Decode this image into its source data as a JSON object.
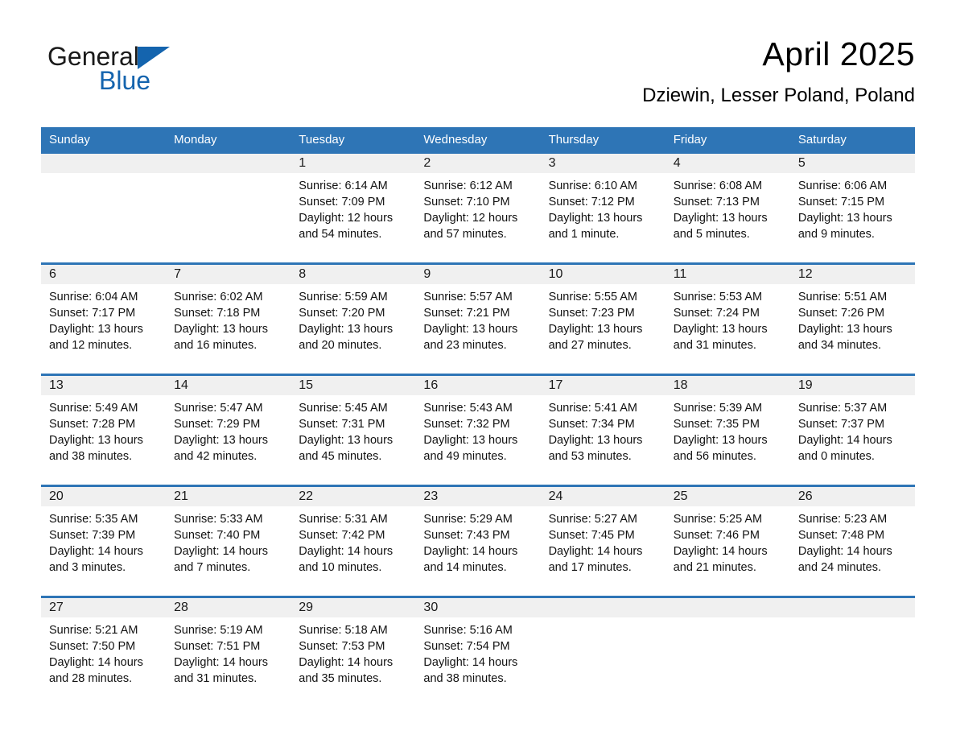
{
  "brand": {
    "name_part1": "General",
    "name_part2": "Blue",
    "logo_icon": "triangle-icon",
    "accent_color": "#1464ae"
  },
  "header": {
    "title": "April 2025",
    "subtitle": "Dziewin, Lesser Poland, Poland"
  },
  "theme": {
    "header_blue": "#2e75b6",
    "daynum_band": "#f0f0f0"
  },
  "weekday_headers": [
    "Sunday",
    "Monday",
    "Tuesday",
    "Wednesday",
    "Thursday",
    "Friday",
    "Saturday"
  ],
  "weeks": [
    [
      {
        "day": "",
        "sunrise": "",
        "sunset": "",
        "daylight1": "",
        "daylight2": ""
      },
      {
        "day": "",
        "sunrise": "",
        "sunset": "",
        "daylight1": "",
        "daylight2": ""
      },
      {
        "day": "1",
        "sunrise": "Sunrise: 6:14 AM",
        "sunset": "Sunset: 7:09 PM",
        "daylight1": "Daylight: 12 hours",
        "daylight2": "and 54 minutes."
      },
      {
        "day": "2",
        "sunrise": "Sunrise: 6:12 AM",
        "sunset": "Sunset: 7:10 PM",
        "daylight1": "Daylight: 12 hours",
        "daylight2": "and 57 minutes."
      },
      {
        "day": "3",
        "sunrise": "Sunrise: 6:10 AM",
        "sunset": "Sunset: 7:12 PM",
        "daylight1": "Daylight: 13 hours",
        "daylight2": "and 1 minute."
      },
      {
        "day": "4",
        "sunrise": "Sunrise: 6:08 AM",
        "sunset": "Sunset: 7:13 PM",
        "daylight1": "Daylight: 13 hours",
        "daylight2": "and 5 minutes."
      },
      {
        "day": "5",
        "sunrise": "Sunrise: 6:06 AM",
        "sunset": "Sunset: 7:15 PM",
        "daylight1": "Daylight: 13 hours",
        "daylight2": "and 9 minutes."
      }
    ],
    [
      {
        "day": "6",
        "sunrise": "Sunrise: 6:04 AM",
        "sunset": "Sunset: 7:17 PM",
        "daylight1": "Daylight: 13 hours",
        "daylight2": "and 12 minutes."
      },
      {
        "day": "7",
        "sunrise": "Sunrise: 6:02 AM",
        "sunset": "Sunset: 7:18 PM",
        "daylight1": "Daylight: 13 hours",
        "daylight2": "and 16 minutes."
      },
      {
        "day": "8",
        "sunrise": "Sunrise: 5:59 AM",
        "sunset": "Sunset: 7:20 PM",
        "daylight1": "Daylight: 13 hours",
        "daylight2": "and 20 minutes."
      },
      {
        "day": "9",
        "sunrise": "Sunrise: 5:57 AM",
        "sunset": "Sunset: 7:21 PM",
        "daylight1": "Daylight: 13 hours",
        "daylight2": "and 23 minutes."
      },
      {
        "day": "10",
        "sunrise": "Sunrise: 5:55 AM",
        "sunset": "Sunset: 7:23 PM",
        "daylight1": "Daylight: 13 hours",
        "daylight2": "and 27 minutes."
      },
      {
        "day": "11",
        "sunrise": "Sunrise: 5:53 AM",
        "sunset": "Sunset: 7:24 PM",
        "daylight1": "Daylight: 13 hours",
        "daylight2": "and 31 minutes."
      },
      {
        "day": "12",
        "sunrise": "Sunrise: 5:51 AM",
        "sunset": "Sunset: 7:26 PM",
        "daylight1": "Daylight: 13 hours",
        "daylight2": "and 34 minutes."
      }
    ],
    [
      {
        "day": "13",
        "sunrise": "Sunrise: 5:49 AM",
        "sunset": "Sunset: 7:28 PM",
        "daylight1": "Daylight: 13 hours",
        "daylight2": "and 38 minutes."
      },
      {
        "day": "14",
        "sunrise": "Sunrise: 5:47 AM",
        "sunset": "Sunset: 7:29 PM",
        "daylight1": "Daylight: 13 hours",
        "daylight2": "and 42 minutes."
      },
      {
        "day": "15",
        "sunrise": "Sunrise: 5:45 AM",
        "sunset": "Sunset: 7:31 PM",
        "daylight1": "Daylight: 13 hours",
        "daylight2": "and 45 minutes."
      },
      {
        "day": "16",
        "sunrise": "Sunrise: 5:43 AM",
        "sunset": "Sunset: 7:32 PM",
        "daylight1": "Daylight: 13 hours",
        "daylight2": "and 49 minutes."
      },
      {
        "day": "17",
        "sunrise": "Sunrise: 5:41 AM",
        "sunset": "Sunset: 7:34 PM",
        "daylight1": "Daylight: 13 hours",
        "daylight2": "and 53 minutes."
      },
      {
        "day": "18",
        "sunrise": "Sunrise: 5:39 AM",
        "sunset": "Sunset: 7:35 PM",
        "daylight1": "Daylight: 13 hours",
        "daylight2": "and 56 minutes."
      },
      {
        "day": "19",
        "sunrise": "Sunrise: 5:37 AM",
        "sunset": "Sunset: 7:37 PM",
        "daylight1": "Daylight: 14 hours",
        "daylight2": "and 0 minutes."
      }
    ],
    [
      {
        "day": "20",
        "sunrise": "Sunrise: 5:35 AM",
        "sunset": "Sunset: 7:39 PM",
        "daylight1": "Daylight: 14 hours",
        "daylight2": "and 3 minutes."
      },
      {
        "day": "21",
        "sunrise": "Sunrise: 5:33 AM",
        "sunset": "Sunset: 7:40 PM",
        "daylight1": "Daylight: 14 hours",
        "daylight2": "and 7 minutes."
      },
      {
        "day": "22",
        "sunrise": "Sunrise: 5:31 AM",
        "sunset": "Sunset: 7:42 PM",
        "daylight1": "Daylight: 14 hours",
        "daylight2": "and 10 minutes."
      },
      {
        "day": "23",
        "sunrise": "Sunrise: 5:29 AM",
        "sunset": "Sunset: 7:43 PM",
        "daylight1": "Daylight: 14 hours",
        "daylight2": "and 14 minutes."
      },
      {
        "day": "24",
        "sunrise": "Sunrise: 5:27 AM",
        "sunset": "Sunset: 7:45 PM",
        "daylight1": "Daylight: 14 hours",
        "daylight2": "and 17 minutes."
      },
      {
        "day": "25",
        "sunrise": "Sunrise: 5:25 AM",
        "sunset": "Sunset: 7:46 PM",
        "daylight1": "Daylight: 14 hours",
        "daylight2": "and 21 minutes."
      },
      {
        "day": "26",
        "sunrise": "Sunrise: 5:23 AM",
        "sunset": "Sunset: 7:48 PM",
        "daylight1": "Daylight: 14 hours",
        "daylight2": "and 24 minutes."
      }
    ],
    [
      {
        "day": "27",
        "sunrise": "Sunrise: 5:21 AM",
        "sunset": "Sunset: 7:50 PM",
        "daylight1": "Daylight: 14 hours",
        "daylight2": "and 28 minutes."
      },
      {
        "day": "28",
        "sunrise": "Sunrise: 5:19 AM",
        "sunset": "Sunset: 7:51 PM",
        "daylight1": "Daylight: 14 hours",
        "daylight2": "and 31 minutes."
      },
      {
        "day": "29",
        "sunrise": "Sunrise: 5:18 AM",
        "sunset": "Sunset: 7:53 PM",
        "daylight1": "Daylight: 14 hours",
        "daylight2": "and 35 minutes."
      },
      {
        "day": "30",
        "sunrise": "Sunrise: 5:16 AM",
        "sunset": "Sunset: 7:54 PM",
        "daylight1": "Daylight: 14 hours",
        "daylight2": "and 38 minutes."
      },
      {
        "day": "",
        "sunrise": "",
        "sunset": "",
        "daylight1": "",
        "daylight2": ""
      },
      {
        "day": "",
        "sunrise": "",
        "sunset": "",
        "daylight1": "",
        "daylight2": ""
      },
      {
        "day": "",
        "sunrise": "",
        "sunset": "",
        "daylight1": "",
        "daylight2": ""
      }
    ]
  ]
}
